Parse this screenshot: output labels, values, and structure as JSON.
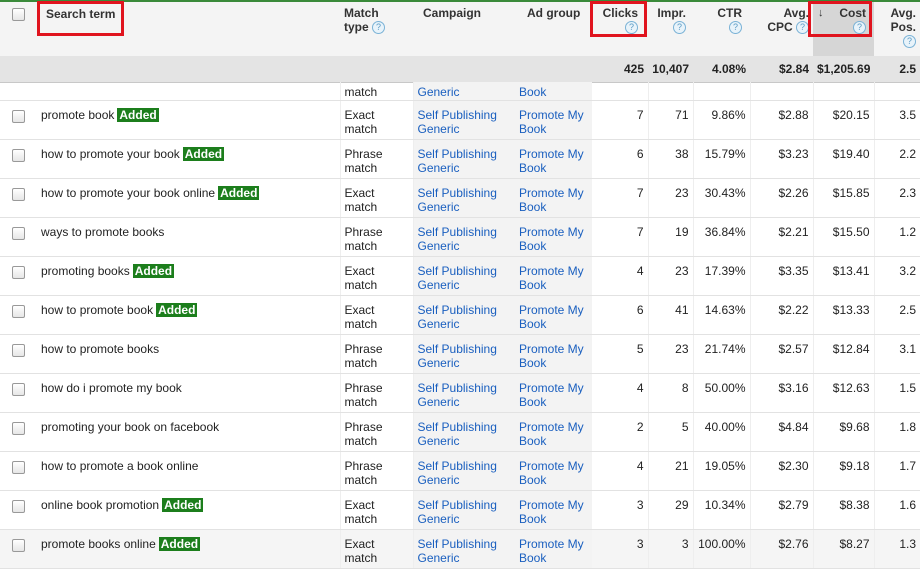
{
  "header": {
    "columns": [
      {
        "key": "select",
        "label": ""
      },
      {
        "key": "search_term",
        "label": "Search term"
      },
      {
        "key": "match_type",
        "label": "Match type"
      },
      {
        "key": "campaign",
        "label": "Campaign"
      },
      {
        "key": "ad_group",
        "label": "Ad group"
      },
      {
        "key": "clicks",
        "label": "Clicks"
      },
      {
        "key": "impr",
        "label": "Impr."
      },
      {
        "key": "ctr",
        "label": "CTR"
      },
      {
        "key": "avg_cpc",
        "label": "Avg. CPC"
      },
      {
        "key": "cost",
        "label": "Cost"
      },
      {
        "key": "avg_pos",
        "label": "Avg. Pos."
      }
    ],
    "match_type_l1": "Match",
    "match_type_l2": "type",
    "avg_cpc_l1": "Avg.",
    "avg_cpc_l2": "CPC",
    "avg_pos_l1": "Avg.",
    "avg_pos_l2": "Pos.",
    "help_glyph": "?",
    "sort_glyph": "↓",
    "sorted_column": "cost",
    "sort_direction": "descending",
    "highlighted_columns": [
      "search_term",
      "clicks",
      "cost"
    ]
  },
  "totals": {
    "clicks": "425",
    "impr": "10,407",
    "ctr": "4.08%",
    "avg_cpc": "$2.84",
    "cost": "$1,205.69",
    "avg_pos": "2.5"
  },
  "partial_row": {
    "match_type": "match",
    "campaign": "Generic",
    "ad_group": "Book"
  },
  "badge_label": "Added",
  "rows": [
    {
      "search_term": "promote book",
      "added": true,
      "match_type": "Exact match",
      "campaign": "Self Publishing Generic",
      "ad_group": "Promote My Book",
      "clicks": "7",
      "impr": "71",
      "ctr": "9.86%",
      "avg_cpc": "$2.88",
      "cost": "$20.15",
      "avg_pos": "3.5"
    },
    {
      "search_term": "how to promote your book",
      "added": true,
      "match_type": "Phrase match",
      "campaign": "Self Publishing Generic",
      "ad_group": "Promote My Book",
      "clicks": "6",
      "impr": "38",
      "ctr": "15.79%",
      "avg_cpc": "$3.23",
      "cost": "$19.40",
      "avg_pos": "2.2"
    },
    {
      "search_term": "how to promote your book online",
      "added": true,
      "match_type": "Exact match",
      "campaign": "Self Publishing Generic",
      "ad_group": "Promote My Book",
      "clicks": "7",
      "impr": "23",
      "ctr": "30.43%",
      "avg_cpc": "$2.26",
      "cost": "$15.85",
      "avg_pos": "2.3"
    },
    {
      "search_term": "ways to promote books",
      "added": false,
      "match_type": "Phrase match",
      "campaign": "Self Publishing Generic",
      "ad_group": "Promote My Book",
      "clicks": "7",
      "impr": "19",
      "ctr": "36.84%",
      "avg_cpc": "$2.21",
      "cost": "$15.50",
      "avg_pos": "1.2"
    },
    {
      "search_term": "promoting books",
      "added": true,
      "match_type": "Exact match",
      "campaign": "Self Publishing Generic",
      "ad_group": "Promote My Book",
      "clicks": "4",
      "impr": "23",
      "ctr": "17.39%",
      "avg_cpc": "$3.35",
      "cost": "$13.41",
      "avg_pos": "3.2"
    },
    {
      "search_term": "how to promote book",
      "added": true,
      "match_type": "Exact match",
      "campaign": "Self Publishing Generic",
      "ad_group": "Promote My Book",
      "clicks": "6",
      "impr": "41",
      "ctr": "14.63%",
      "avg_cpc": "$2.22",
      "cost": "$13.33",
      "avg_pos": "2.5"
    },
    {
      "search_term": "how to promote books",
      "added": false,
      "match_type": "Phrase match",
      "campaign": "Self Publishing Generic",
      "ad_group": "Promote My Book",
      "clicks": "5",
      "impr": "23",
      "ctr": "21.74%",
      "avg_cpc": "$2.57",
      "cost": "$12.84",
      "avg_pos": "3.1"
    },
    {
      "search_term": "how do i promote my book",
      "added": false,
      "match_type": "Phrase match",
      "campaign": "Self Publishing Generic",
      "ad_group": "Promote My Book",
      "clicks": "4",
      "impr": "8",
      "ctr": "50.00%",
      "avg_cpc": "$3.16",
      "cost": "$12.63",
      "avg_pos": "1.5"
    },
    {
      "search_term": "promoting your book on facebook",
      "added": false,
      "match_type": "Phrase match",
      "campaign": "Self Publishing Generic",
      "ad_group": "Promote My Book",
      "clicks": "2",
      "impr": "5",
      "ctr": "40.00%",
      "avg_cpc": "$4.84",
      "cost": "$9.68",
      "avg_pos": "1.8"
    },
    {
      "search_term": "how to promote a book online",
      "added": false,
      "match_type": "Phrase match",
      "campaign": "Self Publishing Generic",
      "ad_group": "Promote My Book",
      "clicks": "4",
      "impr": "21",
      "ctr": "19.05%",
      "avg_cpc": "$2.30",
      "cost": "$9.18",
      "avg_pos": "1.7"
    },
    {
      "search_term": "online book promotion",
      "added": true,
      "match_type": "Exact match",
      "campaign": "Self Publishing Generic",
      "ad_group": "Promote My Book",
      "clicks": "3",
      "impr": "29",
      "ctr": "10.34%",
      "avg_cpc": "$2.79",
      "cost": "$8.38",
      "avg_pos": "1.6"
    },
    {
      "search_term": "promote books online",
      "added": true,
      "match_type": "Exact match",
      "campaign": "Self Publishing Generic",
      "ad_group": "Promote My Book",
      "clicks": "3",
      "impr": "3",
      "ctr": "100.00%",
      "avg_cpc": "$2.76",
      "cost": "$8.27",
      "avg_pos": "1.3"
    }
  ]
}
